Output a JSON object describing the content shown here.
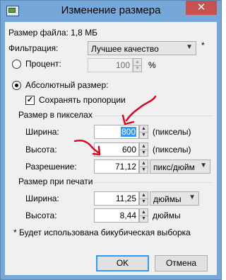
{
  "window": {
    "title": "Изменение размера",
    "close_icon": "close-icon"
  },
  "file_size": "Размер файла: 1,8 МБ",
  "filter": {
    "label": "Фильтрация:",
    "value": "Лучшее качество",
    "star": "*"
  },
  "percent": {
    "label": "Процент:",
    "value": "100",
    "unit": "%"
  },
  "absolute": {
    "label": "Абсолютный размер:",
    "keep_label": "Сохранять пропорции"
  },
  "pixel_size": {
    "section": "Размер в пикселах",
    "width_label": "Ширина:",
    "width_value": "800",
    "width_unit": "(пикселы)",
    "height_label": "Высота:",
    "height_value": "600",
    "height_unit": "(пикселы)",
    "res_label": "Разрешение:",
    "res_value": "71,12",
    "res_unit": "пикс/дюйм"
  },
  "print_size": {
    "section": "Размер при печати",
    "width_label": "Ширина:",
    "width_value": "11,25",
    "width_unit": "дюймы",
    "height_label": "Высота:",
    "height_value": "8,44",
    "height_unit": "дюймы"
  },
  "footnote": "* Будет использована бикубическая выборка",
  "buttons": {
    "ok": "OK",
    "cancel": "Отмена"
  },
  "colors": {
    "accent": "#3399ff",
    "annotation": "#e0001b"
  }
}
